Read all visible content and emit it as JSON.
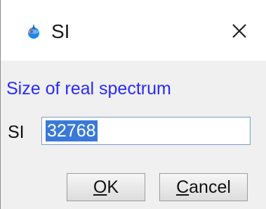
{
  "window": {
    "title": "SI",
    "icon": "topspin-app-icon",
    "close_icon": "close-icon"
  },
  "dialog": {
    "description": "Size of real spectrum",
    "field_label": "SI",
    "field_value": "32768",
    "field_value_selected": true
  },
  "buttons": {
    "ok": {
      "mnemonic": "O",
      "rest": "K"
    },
    "cancel": {
      "mnemonic": "C",
      "rest": "ancel"
    }
  },
  "colors": {
    "description_text": "#2a2aff",
    "selection_bg": "#3a79d8",
    "dialog_bg": "#f0f0f0",
    "titlebar_bg": "#ffffff"
  }
}
